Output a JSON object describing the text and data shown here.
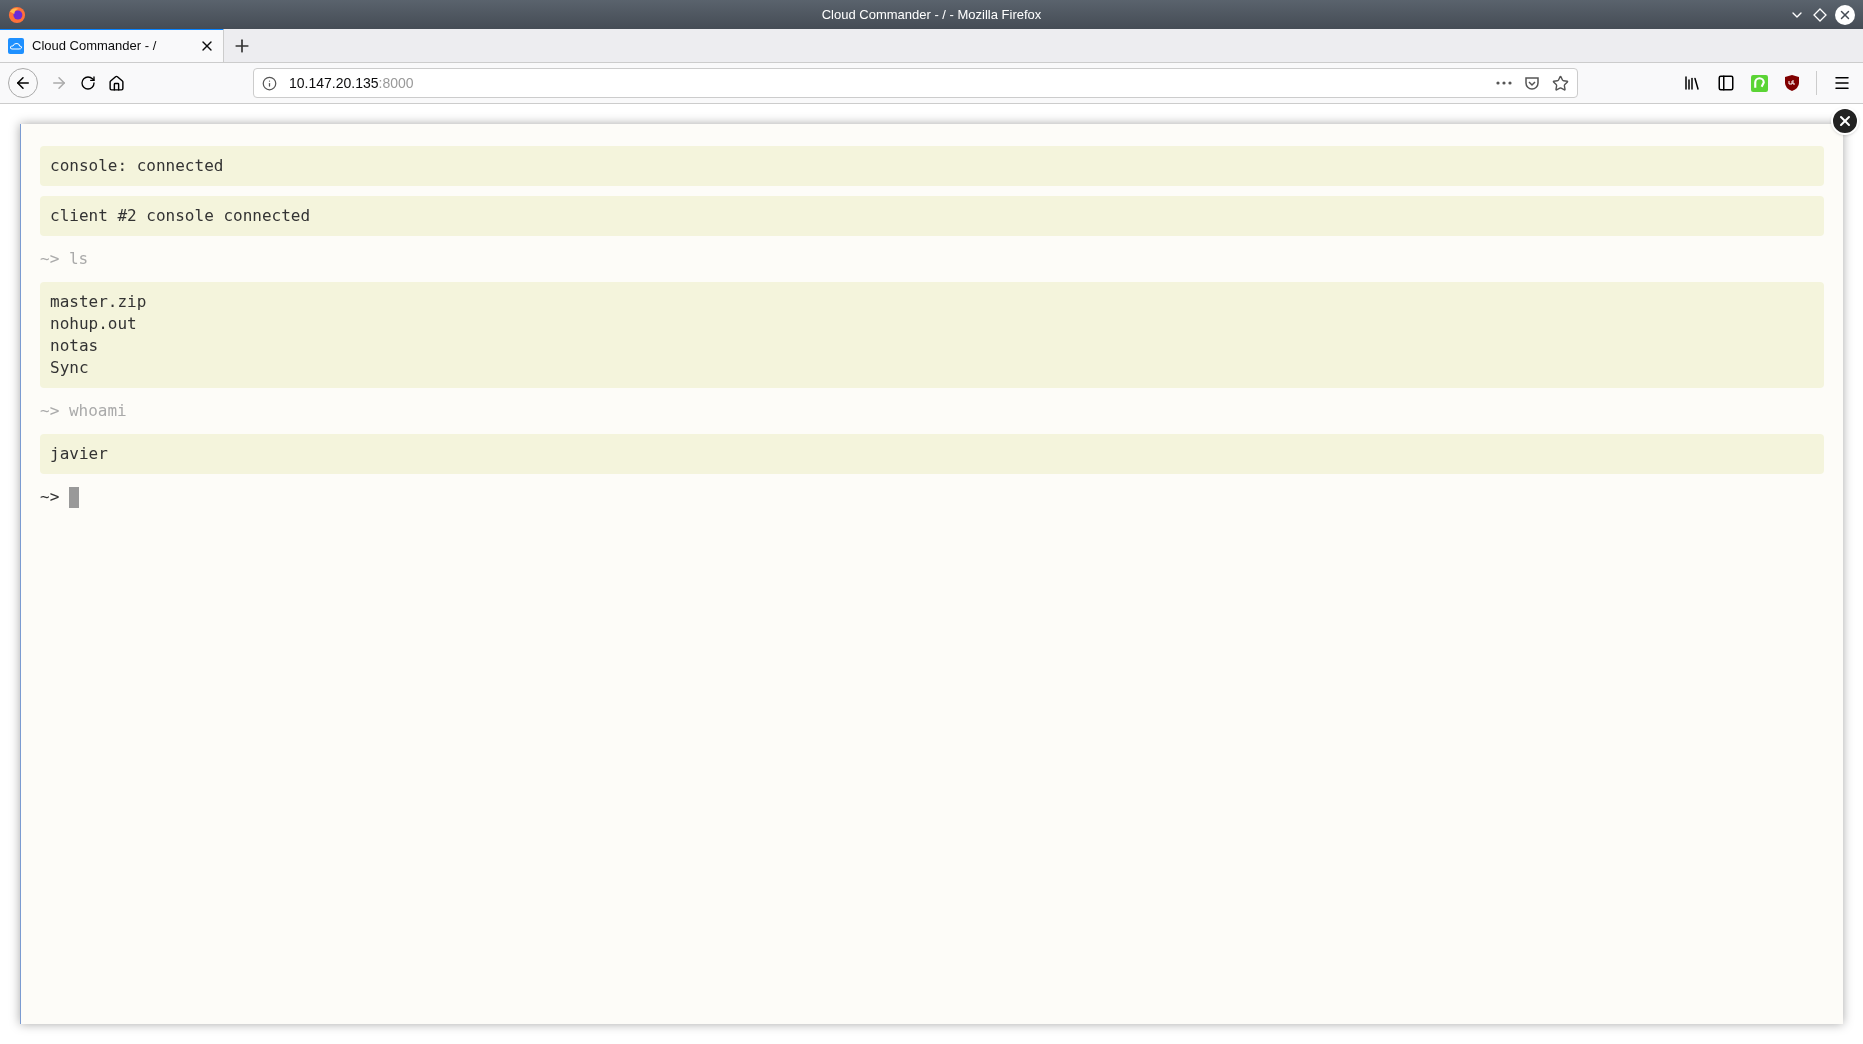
{
  "window": {
    "title": "Cloud Commander - / - Mozilla Firefox"
  },
  "tabs": [
    {
      "label": "Cloud Commander - /",
      "selected": true
    }
  ],
  "address_bar": {
    "host": "10.147.20.135",
    "port": ":8000"
  },
  "console": {
    "entries": [
      {
        "kind": "output",
        "lines": [
          "console: connected"
        ]
      },
      {
        "kind": "output",
        "lines": [
          "client #2 console connected"
        ]
      },
      {
        "kind": "command",
        "prompt": "~>",
        "text": "ls"
      },
      {
        "kind": "output",
        "lines": [
          "master.zip",
          "nohup.out",
          "notas",
          "Sync"
        ]
      },
      {
        "kind": "command",
        "prompt": "~>",
        "text": "whoami"
      },
      {
        "kind": "output",
        "lines": [
          "javier"
        ]
      }
    ],
    "input": {
      "prompt": "~>"
    }
  }
}
